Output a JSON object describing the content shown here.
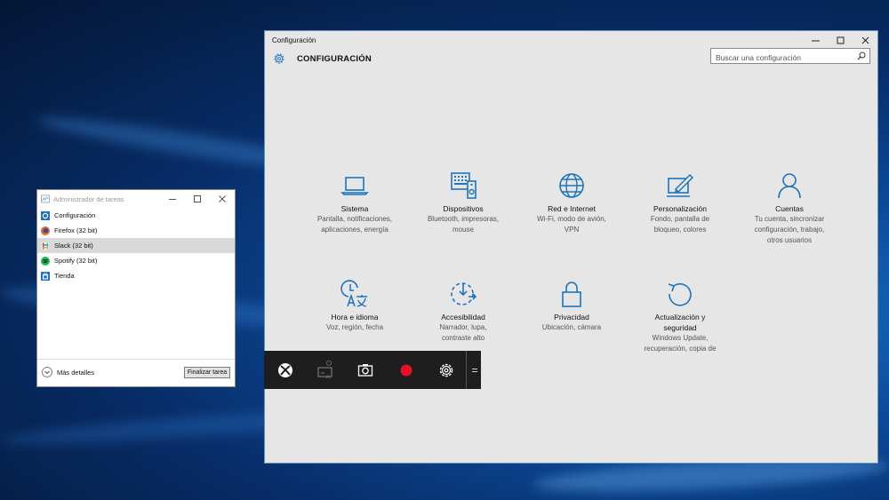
{
  "settings": {
    "window_title": "Configuración",
    "header_title": "CONFIGURACIÓN",
    "search_placeholder": "Buscar una configuración",
    "accent": "#1e73be",
    "tiles": [
      {
        "title": "Sistema",
        "desc": [
          "Pantalla, notificaciones,",
          "aplicaciones, energía"
        ],
        "icon": "laptop-icon"
      },
      {
        "title": "Dispositivos",
        "desc": [
          "Bluetooth, impresoras,",
          "mouse"
        ],
        "icon": "devices-icon"
      },
      {
        "title": "Red e Internet",
        "desc": [
          "Wi-Fi, modo de avión,",
          "VPN"
        ],
        "icon": "globe-icon"
      },
      {
        "title": "Personalización",
        "desc": [
          "Fondo, pantalla de",
          "bloqueo, colores"
        ],
        "icon": "paint-icon"
      },
      {
        "title": "Cuentas",
        "desc": [
          "Tu cuenta, sincronizar",
          "configuración, trabajo,",
          "otros usuarios"
        ],
        "icon": "person-icon"
      },
      {
        "title": "Hora e idioma",
        "desc": [
          "Voz, región, fecha"
        ],
        "icon": "time-language-icon"
      },
      {
        "title": "Accesibilidad",
        "desc": [
          "Narrador, lupa,",
          "contraste alto"
        ],
        "icon": "accessibility-icon"
      },
      {
        "title": "Privacidad",
        "desc": [
          "Ubicación, cámara"
        ],
        "icon": "lock-icon"
      },
      {
        "title": "Actualización y",
        "desc": [
          "seguridad",
          "Windows Update,",
          "recuperación, copia de"
        ],
        "icon": "update-icon"
      }
    ]
  },
  "gamebar": {
    "buttons": [
      "xbox-icon",
      "screenshot-window-icon",
      "camera-icon",
      "record-icon",
      "gear-icon"
    ],
    "record_color": "#e81123"
  },
  "taskmanager": {
    "window_title": "Administrador de tareas",
    "processes": [
      {
        "name": "Configuración",
        "icon": "settings-app-icon"
      },
      {
        "name": "Firefox (32 bit)",
        "icon": "firefox-icon"
      },
      {
        "name": "Slack (32 bit)",
        "icon": "slack-icon",
        "selected": true
      },
      {
        "name": "Spotify (32 bit)",
        "icon": "spotify-icon"
      },
      {
        "name": "Tienda",
        "icon": "store-icon"
      }
    ],
    "more_details": "Más detalles",
    "end_task": "Finalizar tarea"
  }
}
